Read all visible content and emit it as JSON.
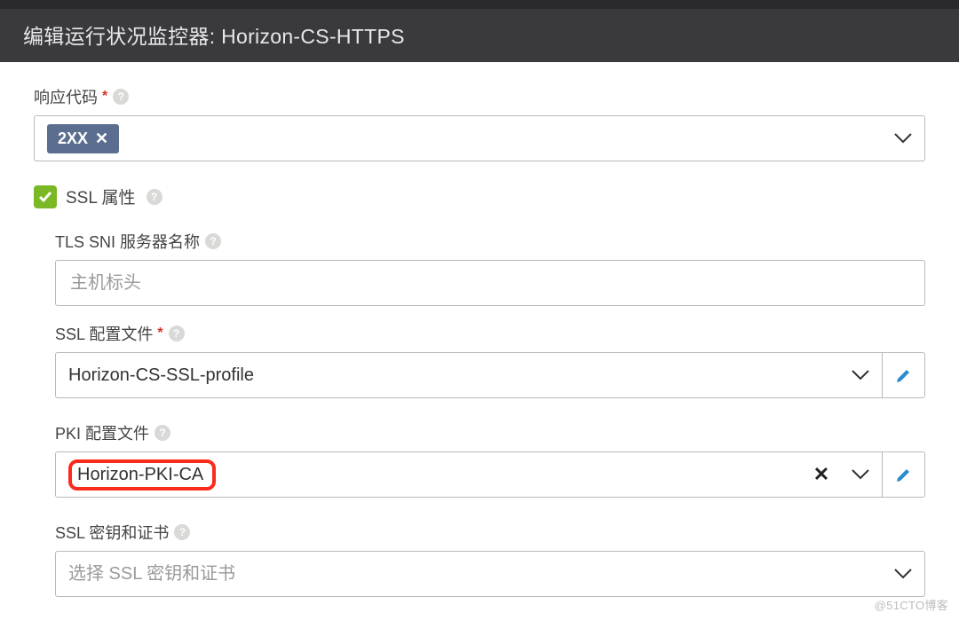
{
  "header": {
    "title": "编辑运行状况监控器: Horizon-CS-HTTPS"
  },
  "response_codes": {
    "label": "响应代码",
    "required": true,
    "chip": "2XX"
  },
  "ssl_attrs": {
    "label": "SSL 属性",
    "checked": true
  },
  "tls_sni": {
    "label": "TLS SNI 服务器名称",
    "placeholder": "主机标头",
    "value": ""
  },
  "ssl_profile": {
    "label": "SSL 配置文件",
    "required": true,
    "value": "Horizon-CS-SSL-profile"
  },
  "pki_profile": {
    "label": "PKI 配置文件",
    "value": "Horizon-PKI-CA"
  },
  "ssl_key_cert": {
    "label": "SSL 密钥和证书",
    "placeholder": "选择 SSL 密钥和证书",
    "value": ""
  },
  "watermark": "@51CTO博客"
}
